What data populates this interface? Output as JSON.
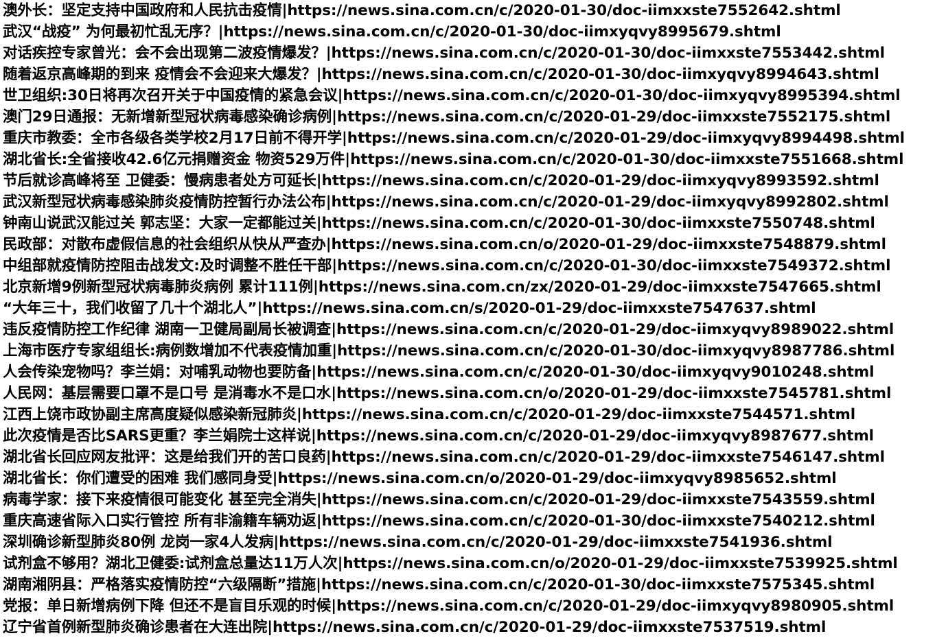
{
  "lines": [
    "澳外长：坚定支持中国政府和人民抗击疫情|https://news.sina.com.cn/c/2020-01-30/doc-iimxxste7552642.shtml",
    "武汉“战疫” 为何最初忙乱无序？|https://news.sina.com.cn/c/2020-01-30/doc-iimxyqvy8995679.shtml",
    "对话疾控专家曾光：会不会出现第二波疫情爆发？|https://news.sina.com.cn/c/2020-01-30/doc-iimxxste7553442.shtml",
    "随着返京高峰期的到来 疫情会不会迎来大爆发？|https://news.sina.com.cn/c/2020-01-30/doc-iimxyqvy8994643.shtml",
    "世卫组织:30日将再次召开关于中国疫情的紧急会议|https://news.sina.com.cn/c/2020-01-30/doc-iimxyqvy8995394.shtml",
    "澳门29日通报：无新增新型冠状病毒感染确诊病例|https://news.sina.com.cn/c/2020-01-29/doc-iimxxste7552175.shtml",
    "重庆市教委：全市各级各类学校2月17日前不得开学|https://news.sina.com.cn/c/2020-01-29/doc-iimxyqvy8994498.shtml",
    "湖北省长:全省接收42.6亿元捐赠资金 物资529万件|https://news.sina.com.cn/c/2020-01-30/doc-iimxxste7551668.shtml",
    "节后就诊高峰将至 卫健委：慢病患者处方可延长|https://news.sina.com.cn/c/2020-01-29/doc-iimxyqvy8993592.shtml",
    "武汉新型冠状病毒感染肺炎疫情防控暂行办法公布|https://news.sina.com.cn/c/2020-01-29/doc-iimxyqvy8992802.shtml",
    "钟南山说武汉能过关 郭志坚：大家一定都能过关|https://news.sina.com.cn/c/2020-01-30/doc-iimxxste7550748.shtml",
    "民政部：对散布虚假信息的社会组织从快从严查办|https://news.sina.com.cn/o/2020-01-29/doc-iimxxste7548879.shtml",
    "中组部就疫情防控阻击战发文:及时调整不胜任干部|https://news.sina.com.cn/c/2020-01-30/doc-iimxxste7549372.shtml",
    "北京新增9例新型冠状病毒肺炎病例 累计111例|https://news.sina.com.cn/zx/2020-01-29/doc-iimxxste7547665.shtml",
    "“大年三十，我们收留了几十个湖北人”|https://news.sina.com.cn/s/2020-01-29/doc-iimxxste7547637.shtml",
    "违反疫情防控工作纪律 湖南一卫健局副局长被调查|https://news.sina.com.cn/c/2020-01-29/doc-iimxyqvy8989022.shtml",
    "上海市医疗专家组组长:病例数增加不代表疫情加重|https://news.sina.com.cn/c/2020-01-30/doc-iimxyqvy8987786.shtml",
    "人会传染宠物吗？李兰娟：对哺乳动物也要防备|https://news.sina.com.cn/c/2020-01-30/doc-iimxyqvy9010248.shtml",
    "人民网：基层需要口罩不是口号 是消毒水不是口水|https://news.sina.com.cn/o/2020-01-29/doc-iimxxste7545781.shtml",
    "江西上饶市政协副主席高度疑似感染新冠肺炎|https://news.sina.com.cn/c/2020-01-29/doc-iimxxste7544571.shtml",
    "此次疫情是否比SARS更重？李兰娟院士这样说|https://news.sina.com.cn/c/2020-01-29/doc-iimxyqvy8987677.shtml",
    "湖北省长回应网友批评：这是给我们开的苦口良药|https://news.sina.com.cn/c/2020-01-29/doc-iimxxste7546147.shtml",
    "湖北省长：你们遭受的困难 我们感同身受|https://news.sina.com.cn/o/2020-01-29/doc-iimxyqvy8985652.shtml",
    "病毒学家：接下来疫情很可能变化 甚至完全消失|https://news.sina.com.cn/c/2020-01-29/doc-iimxxste7543559.shtml",
    "重庆高速省际入口实行管控 所有非渝籍车辆劝返|https://news.sina.com.cn/c/2020-01-30/doc-iimxxste7540212.shtml",
    "深圳确诊新型肺炎80例 龙岗一家4人发病|https://news.sina.com.cn/c/2020-01-29/doc-iimxxste7541936.shtml",
    "试剂盒不够用？湖北卫健委:试剂盒总量达11万人次|https://news.sina.com.cn/o/2020-01-29/doc-iimxxste7539925.shtml",
    "湖南湘阴县：严格落实疫情防控“六级隔断”措施|https://news.sina.com.cn/c/2020-01-30/doc-iimxxste7575345.shtml",
    "党报：单日新增病例下降 但还不是盲目乐观的时候|https://news.sina.com.cn/c/2020-01-29/doc-iimxyqvy8980905.shtml",
    "辽宁省首例新型肺炎确诊患者在大连出院|https://news.sina.com.cn/c/2020-01-29/doc-iimxxste7537519.shtml"
  ]
}
